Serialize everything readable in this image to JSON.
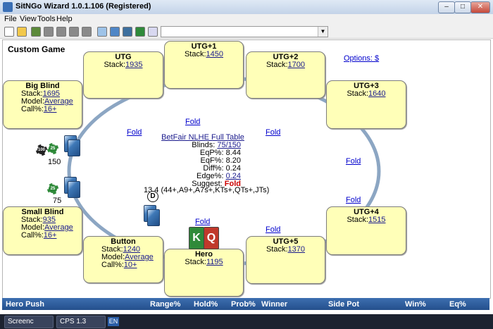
{
  "window": {
    "title": "SitNGo Wizard 1.0.1.106 (Registered)"
  },
  "menu": [
    "File",
    "View",
    "Tools",
    "Help"
  ],
  "game": {
    "title": "Custom Game",
    "options_label": "Options: $"
  },
  "seats": {
    "utg": {
      "name": "UTG",
      "stack_label": "Stack:",
      "stack": "1935"
    },
    "utg1": {
      "name": "UTG+1",
      "stack_label": "Stack:",
      "stack": "1450"
    },
    "utg2": {
      "name": "UTG+2",
      "stack_label": "Stack:",
      "stack": "1700"
    },
    "utg3": {
      "name": "UTG+3",
      "stack_label": "Stack:",
      "stack": "1640"
    },
    "utg4": {
      "name": "UTG+4",
      "stack_label": "Stack:",
      "stack": "1515"
    },
    "utg5": {
      "name": "UTG+5",
      "stack_label": "Stack:",
      "stack": "1370"
    },
    "hero": {
      "name": "Hero",
      "stack_label": "Stack:",
      "stack": "1195"
    },
    "button": {
      "name": "Button",
      "stack_label": "Stack:",
      "stack": "1240",
      "model_label": "Model:",
      "model": "Average",
      "call_label": "Call%:",
      "call": "10+"
    },
    "small_blind": {
      "name": "Small Blind",
      "stack_label": "Stack:",
      "stack": "935",
      "model_label": "Model:",
      "model": "Average",
      "call_label": "Call%:",
      "call": "16+"
    },
    "big_blind": {
      "name": "Big Blind",
      "stack_label": "Stack:",
      "stack": "1695",
      "model_label": "Model:",
      "model": "Average",
      "call_label": "Call%:",
      "call": "16+"
    }
  },
  "actions": {
    "fold_utg": "Fold",
    "fold_utg1": "Fold",
    "fold_utg2": "Fold",
    "fold_utg3": "Fold",
    "fold_utg4": "Fold",
    "fold_utg5": "Fold",
    "fold_hero": "Fold"
  },
  "center": {
    "table_name": "BetFair NLHE Full Table",
    "blinds_label": "Blinds:",
    "blinds": "75/150",
    "eqp_label": "EqP%:",
    "eqp": "8.44",
    "eqf_label": "EqF%:",
    "eqf": "8.20",
    "diff_label": "Diff%:",
    "diff": "0.24",
    "edge_label": "Edge%:",
    "edge": "0.24",
    "suggest_label": "Suggest:",
    "suggest": "Fold",
    "hand_range": "13.4 (44+,A9+,A7s+,KTs+,QTs+,JTs)"
  },
  "pots": {
    "bb_bet": "150",
    "sb_bet": "75",
    "dealer_button": "D"
  },
  "hero_cards": [
    "K",
    "Q"
  ],
  "chips": [
    "100",
    "25",
    "25"
  ],
  "table_header": {
    "c1": "Hero Push",
    "c2": "Range%",
    "c3": "Hold%",
    "c4": "Prob%",
    "c5": "Winner",
    "c6": "Side Pot",
    "c7": "Win%",
    "c8": "Eq%"
  },
  "taskbar": {
    "task1": "Screenc",
    "task2": "CPS 1.3",
    "lang": "EN"
  },
  "colors": {
    "seat_fill": "#ffffb8",
    "table_rail": "#8ca6c3",
    "header_blue": "#2f5f9e"
  }
}
